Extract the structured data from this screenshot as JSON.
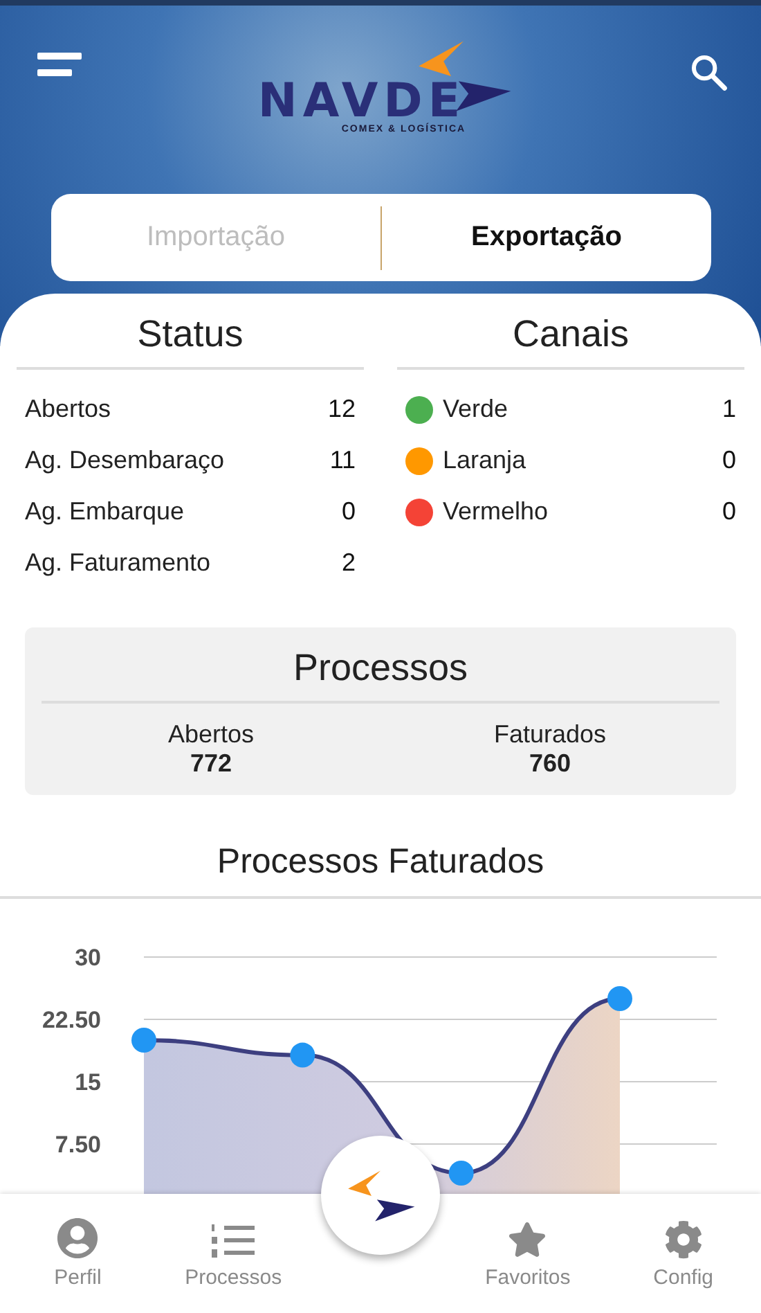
{
  "header": {
    "logo_text": "NAVDE",
    "logo_tagline": "COMEX & LOGÍSTICA"
  },
  "tabs": [
    {
      "label": "Importação",
      "selected": false
    },
    {
      "label": "Exportação",
      "selected": true
    }
  ],
  "status": {
    "title": "Status",
    "rows": [
      {
        "label": "Abertos",
        "value": "12"
      },
      {
        "label": "Ag. Desembaraço",
        "value": "11"
      },
      {
        "label": "Ag. Embarque",
        "value": "0"
      },
      {
        "label": "Ag. Faturamento",
        "value": "2"
      }
    ]
  },
  "canais": {
    "title": "Canais",
    "rows": [
      {
        "label": "Verde",
        "value": "1",
        "color": "#4caf50"
      },
      {
        "label": "Laranja",
        "value": "0",
        "color": "#ff9800"
      },
      {
        "label": "Vermelho",
        "value": "0",
        "color": "#f44336"
      }
    ]
  },
  "processos": {
    "title": "Processos",
    "items": [
      {
        "label": "Abertos",
        "value": "772"
      },
      {
        "label": "Faturados",
        "value": "760"
      }
    ]
  },
  "faturados": {
    "title": "Processos Faturados",
    "chart_data": {
      "type": "area",
      "grid": true,
      "series": [
        {
          "color": "#3d3f80",
          "values": [
            20,
            18.2,
            4,
            25
          ]
        }
      ],
      "ylim": [
        0,
        30
      ],
      "yticks": [
        {
          "value": 7.5,
          "label": "7.50"
        },
        {
          "value": 15,
          "label": "15"
        },
        {
          "value": 22.5,
          "label": "22.50"
        },
        {
          "value": 30,
          "label": "30"
        }
      ]
    }
  },
  "bottom_nav": [
    {
      "kind": "profile",
      "label": "Perfil"
    },
    {
      "kind": "list",
      "label": "Processos"
    },
    {
      "kind": "home"
    },
    {
      "kind": "star",
      "label": "Favoritos"
    },
    {
      "kind": "gear",
      "label": "Config"
    }
  ]
}
